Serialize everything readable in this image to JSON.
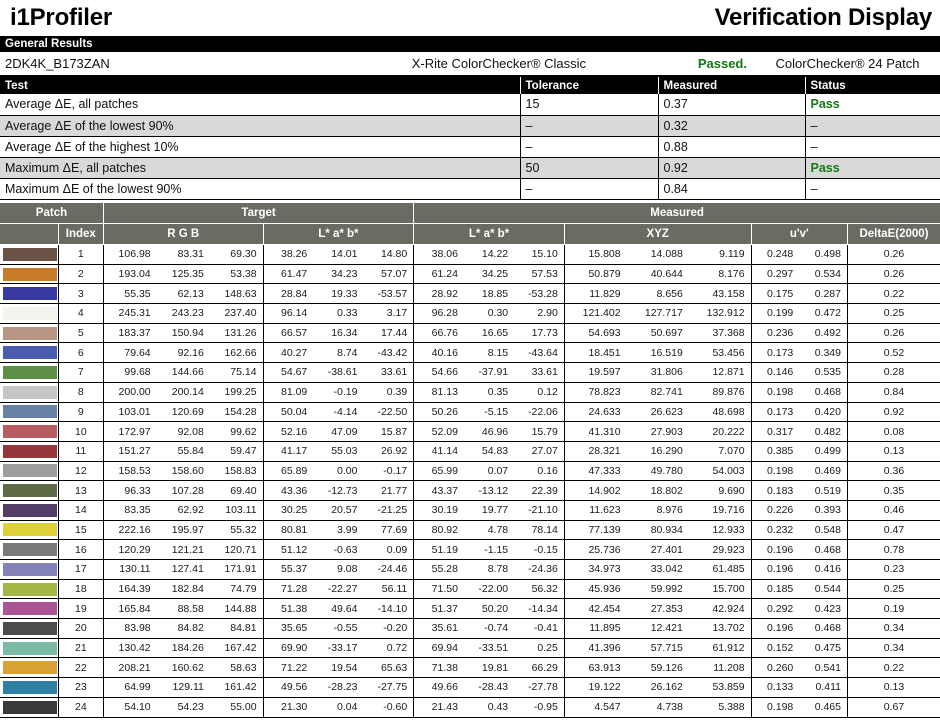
{
  "header": {
    "app_title": "i1Profiler",
    "report_title": "Verification Display"
  },
  "general_results": {
    "section_label": "General Results",
    "device_id": "2DK4K_B173ZAN",
    "target_name": "X-Rite ColorChecker® Classic",
    "passed_label": "Passed.",
    "patch_set": "ColorChecker® 24 Patch",
    "columns": [
      "Test",
      "Tolerance",
      "Measured",
      "Status"
    ],
    "rows": [
      {
        "test": "Average ΔE, all patches",
        "tolerance": "15",
        "measured": "0.37",
        "status": "Pass"
      },
      {
        "test": "Average ΔE of the lowest 90%",
        "tolerance": "–",
        "measured": "0.32",
        "status": "–"
      },
      {
        "test": "Average ΔE of the highest 10%",
        "tolerance": "–",
        "measured": "0.88",
        "status": "–"
      },
      {
        "test": "Maximum ΔE, all patches",
        "tolerance": "50",
        "measured": "0.92",
        "status": "Pass"
      },
      {
        "test": "Maximum ΔE of the lowest 90%",
        "tolerance": "–",
        "measured": "0.84",
        "status": "–"
      }
    ]
  },
  "patch_table": {
    "group_headers": {
      "patch": "Patch",
      "target": "Target",
      "measured": "Measured"
    },
    "sub_headers": {
      "swatch": "",
      "index": "Index",
      "target_rgb": "R G B",
      "target_lab": "L* a* b*",
      "measured_lab": "L* a* b*",
      "measured_xyz": "XYZ",
      "measured_uv": "u'v'",
      "delta_e": "DeltaE(2000)"
    },
    "rows": [
      {
        "index": "1",
        "color": "#6b5247",
        "rgb": [
          "106.98",
          "83.31",
          "69.30"
        ],
        "t_lab": [
          "38.26",
          "14.01",
          "14.80"
        ],
        "m_lab": [
          "38.06",
          "14.22",
          "15.10"
        ],
        "xyz": [
          "15.808",
          "14.088",
          "9.119"
        ],
        "uv": [
          "0.248",
          "0.498"
        ],
        "de": "0.26"
      },
      {
        "index": "2",
        "color": "#c87c2a",
        "rgb": [
          "193.04",
          "125.35",
          "53.38"
        ],
        "t_lab": [
          "61.47",
          "34.23",
          "57.07"
        ],
        "m_lab": [
          "61.24",
          "34.25",
          "57.53"
        ],
        "xyz": [
          "50.879",
          "40.644",
          "8.176"
        ],
        "uv": [
          "0.297",
          "0.534"
        ],
        "de": "0.26"
      },
      {
        "index": "3",
        "color": "#3739a0",
        "rgb": [
          "55.35",
          "62.13",
          "148.63"
        ],
        "t_lab": [
          "28.84",
          "19.33",
          "-53.57"
        ],
        "m_lab": [
          "28.92",
          "18.85",
          "-53.28"
        ],
        "xyz": [
          "11.829",
          "8.656",
          "43.158"
        ],
        "uv": [
          "0.175",
          "0.287"
        ],
        "de": "0.22"
      },
      {
        "index": "4",
        "color": "#f5f3ee",
        "rgb": [
          "245.31",
          "243.23",
          "237.40"
        ],
        "t_lab": [
          "96.14",
          "0.33",
          "3.17"
        ],
        "m_lab": [
          "96.28",
          "0.30",
          "2.90"
        ],
        "xyz": [
          "121.402",
          "127.717",
          "132.912"
        ],
        "uv": [
          "0.199",
          "0.472"
        ],
        "de": "0.25"
      },
      {
        "index": "5",
        "color": "#b79483",
        "rgb": [
          "183.37",
          "150.94",
          "131.26"
        ],
        "t_lab": [
          "66.57",
          "16.34",
          "17.44"
        ],
        "m_lab": [
          "66.76",
          "16.65",
          "17.73"
        ],
        "xyz": [
          "54.693",
          "50.697",
          "37.368"
        ],
        "uv": [
          "0.236",
          "0.492"
        ],
        "de": "0.26"
      },
      {
        "index": "6",
        "color": "#4a5cad",
        "rgb": [
          "79.64",
          "92.16",
          "162.66"
        ],
        "t_lab": [
          "40.27",
          "8.74",
          "-43.42"
        ],
        "m_lab": [
          "40.16",
          "8.15",
          "-43.64"
        ],
        "xyz": [
          "18.451",
          "16.519",
          "53.456"
        ],
        "uv": [
          "0.173",
          "0.349"
        ],
        "de": "0.52"
      },
      {
        "index": "7",
        "color": "#5d8f47",
        "rgb": [
          "99.68",
          "144.66",
          "75.14"
        ],
        "t_lab": [
          "54.67",
          "-38.61",
          "33.61"
        ],
        "m_lab": [
          "54.66",
          "-37.91",
          "33.61"
        ],
        "xyz": [
          "19.597",
          "31.806",
          "12.871"
        ],
        "uv": [
          "0.146",
          "0.535"
        ],
        "de": "0.28"
      },
      {
        "index": "8",
        "color": "#c6c6c6",
        "rgb": [
          "200.00",
          "200.14",
          "199.25"
        ],
        "t_lab": [
          "81.09",
          "-0.19",
          "0.39"
        ],
        "m_lab": [
          "81.13",
          "0.35",
          "0.12"
        ],
        "xyz": [
          "78.823",
          "82.741",
          "89.876"
        ],
        "uv": [
          "0.198",
          "0.468"
        ],
        "de": "0.84"
      },
      {
        "index": "9",
        "color": "#6680a6",
        "rgb": [
          "103.01",
          "120.69",
          "154.28"
        ],
        "t_lab": [
          "50.04",
          "-4.14",
          "-22.50"
        ],
        "m_lab": [
          "50.26",
          "-5.15",
          "-22.06"
        ],
        "xyz": [
          "24.633",
          "26.623",
          "48.698"
        ],
        "uv": [
          "0.173",
          "0.420"
        ],
        "de": "0.92"
      },
      {
        "index": "10",
        "color": "#b95b62",
        "rgb": [
          "172.97",
          "92.08",
          "99.62"
        ],
        "t_lab": [
          "52.16",
          "47.09",
          "15.87"
        ],
        "m_lab": [
          "52.09",
          "46.96",
          "15.79"
        ],
        "xyz": [
          "41.310",
          "27.903",
          "20.222"
        ],
        "uv": [
          "0.317",
          "0.482"
        ],
        "de": "0.08"
      },
      {
        "index": "11",
        "color": "#98373b",
        "rgb": [
          "151.27",
          "55.84",
          "59.47"
        ],
        "t_lab": [
          "41.17",
          "55.03",
          "26.92"
        ],
        "m_lab": [
          "41.14",
          "54.83",
          "27.07"
        ],
        "xyz": [
          "28.321",
          "16.290",
          "7.070"
        ],
        "uv": [
          "0.385",
          "0.499"
        ],
        "de": "0.13"
      },
      {
        "index": "12",
        "color": "#9e9e9e",
        "rgb": [
          "158.53",
          "158.60",
          "158.83"
        ],
        "t_lab": [
          "65.89",
          "0.00",
          "-0.17"
        ],
        "m_lab": [
          "65.99",
          "0.07",
          "0.16"
        ],
        "xyz": [
          "47.333",
          "49.780",
          "54.003"
        ],
        "uv": [
          "0.198",
          "0.469"
        ],
        "de": "0.36"
      },
      {
        "index": "13",
        "color": "#5f6b45",
        "rgb": [
          "96.33",
          "107.28",
          "69.40"
        ],
        "t_lab": [
          "43.36",
          "-12.73",
          "21.77"
        ],
        "m_lab": [
          "43.37",
          "-13.12",
          "22.39"
        ],
        "xyz": [
          "14.902",
          "18.802",
          "9.690"
        ],
        "uv": [
          "0.183",
          "0.519"
        ],
        "de": "0.35"
      },
      {
        "index": "14",
        "color": "#533e67",
        "rgb": [
          "83.35",
          "62.92",
          "103.11"
        ],
        "t_lab": [
          "30.25",
          "20.57",
          "-21.25"
        ],
        "m_lab": [
          "30.19",
          "19.77",
          "-21.10"
        ],
        "xyz": [
          "11.623",
          "8.976",
          "19.716"
        ],
        "uv": [
          "0.226",
          "0.393"
        ],
        "de": "0.46"
      },
      {
        "index": "15",
        "color": "#ded037",
        "rgb": [
          "222.16",
          "195.97",
          "55.32"
        ],
        "t_lab": [
          "80.81",
          "3.99",
          "77.69"
        ],
        "m_lab": [
          "80.92",
          "4.78",
          "78.14"
        ],
        "xyz": [
          "77.139",
          "80.934",
          "12.933"
        ],
        "uv": [
          "0.232",
          "0.548"
        ],
        "de": "0.47"
      },
      {
        "index": "16",
        "color": "#797979",
        "rgb": [
          "120.29",
          "121.21",
          "120.71"
        ],
        "t_lab": [
          "51.12",
          "-0.63",
          "0.09"
        ],
        "m_lab": [
          "51.19",
          "-1.15",
          "-0.15"
        ],
        "xyz": [
          "25.736",
          "27.401",
          "29.923"
        ],
        "uv": [
          "0.196",
          "0.468"
        ],
        "de": "0.78"
      },
      {
        "index": "17",
        "color": "#8382b6",
        "rgb": [
          "130.11",
          "127.41",
          "171.91"
        ],
        "t_lab": [
          "55.37",
          "9.08",
          "-24.46"
        ],
        "m_lab": [
          "55.28",
          "8.78",
          "-24.36"
        ],
        "xyz": [
          "34.973",
          "33.042",
          "61.485"
        ],
        "uv": [
          "0.196",
          "0.416"
        ],
        "de": "0.23"
      },
      {
        "index": "18",
        "color": "#a3b844",
        "rgb": [
          "164.39",
          "182.84",
          "74.79"
        ],
        "t_lab": [
          "71.28",
          "-22.27",
          "56.11"
        ],
        "m_lab": [
          "71.50",
          "-22.00",
          "56.32"
        ],
        "xyz": [
          "45.936",
          "59.992",
          "15.700"
        ],
        "uv": [
          "0.185",
          "0.544"
        ],
        "de": "0.25"
      },
      {
        "index": "19",
        "color": "#ab5595",
        "rgb": [
          "165.84",
          "88.58",
          "144.88"
        ],
        "t_lab": [
          "51.38",
          "49.64",
          "-14.10"
        ],
        "m_lab": [
          "51.37",
          "50.20",
          "-14.34"
        ],
        "xyz": [
          "42.454",
          "27.353",
          "42.924"
        ],
        "uv": [
          "0.292",
          "0.423"
        ],
        "de": "0.19"
      },
      {
        "index": "20",
        "color": "#4d4d4d",
        "rgb": [
          "83.98",
          "84.82",
          "84.81"
        ],
        "t_lab": [
          "35.65",
          "-0.55",
          "-0.20"
        ],
        "m_lab": [
          "35.61",
          "-0.74",
          "-0.41"
        ],
        "xyz": [
          "11.895",
          "12.421",
          "13.702"
        ],
        "uv": [
          "0.196",
          "0.468"
        ],
        "de": "0.34"
      },
      {
        "index": "21",
        "color": "#7bbaa7",
        "rgb": [
          "130.42",
          "184.26",
          "167.42"
        ],
        "t_lab": [
          "69.90",
          "-33.17",
          "0.72"
        ],
        "m_lab": [
          "69.94",
          "-33.51",
          "0.25"
        ],
        "xyz": [
          "41.396",
          "57.715",
          "61.912"
        ],
        "uv": [
          "0.152",
          "0.475"
        ],
        "de": "0.34"
      },
      {
        "index": "22",
        "color": "#d9a233",
        "rgb": [
          "208.21",
          "160.62",
          "58.63"
        ],
        "t_lab": [
          "71.22",
          "19.54",
          "65.63"
        ],
        "m_lab": [
          "71.38",
          "19.81",
          "66.29"
        ],
        "xyz": [
          "63.913",
          "59.126",
          "11.208"
        ],
        "uv": [
          "0.260",
          "0.541"
        ],
        "de": "0.22"
      },
      {
        "index": "23",
        "color": "#2f80a5",
        "rgb": [
          "64.99",
          "129.11",
          "161.42"
        ],
        "t_lab": [
          "49.56",
          "-28.23",
          "-27.75"
        ],
        "m_lab": [
          "49.66",
          "-28.43",
          "-27.78"
        ],
        "xyz": [
          "19.122",
          "26.162",
          "53.859"
        ],
        "uv": [
          "0.133",
          "0.411"
        ],
        "de": "0.13"
      },
      {
        "index": "24",
        "color": "#393939",
        "rgb": [
          "54.10",
          "54.23",
          "55.00"
        ],
        "t_lab": [
          "21.30",
          "0.04",
          "-0.60"
        ],
        "m_lab": [
          "21.43",
          "0.43",
          "-0.95"
        ],
        "xyz": [
          "4.547",
          "4.738",
          "5.388"
        ],
        "uv": [
          "0.198",
          "0.465"
        ],
        "de": "0.67"
      }
    ]
  }
}
